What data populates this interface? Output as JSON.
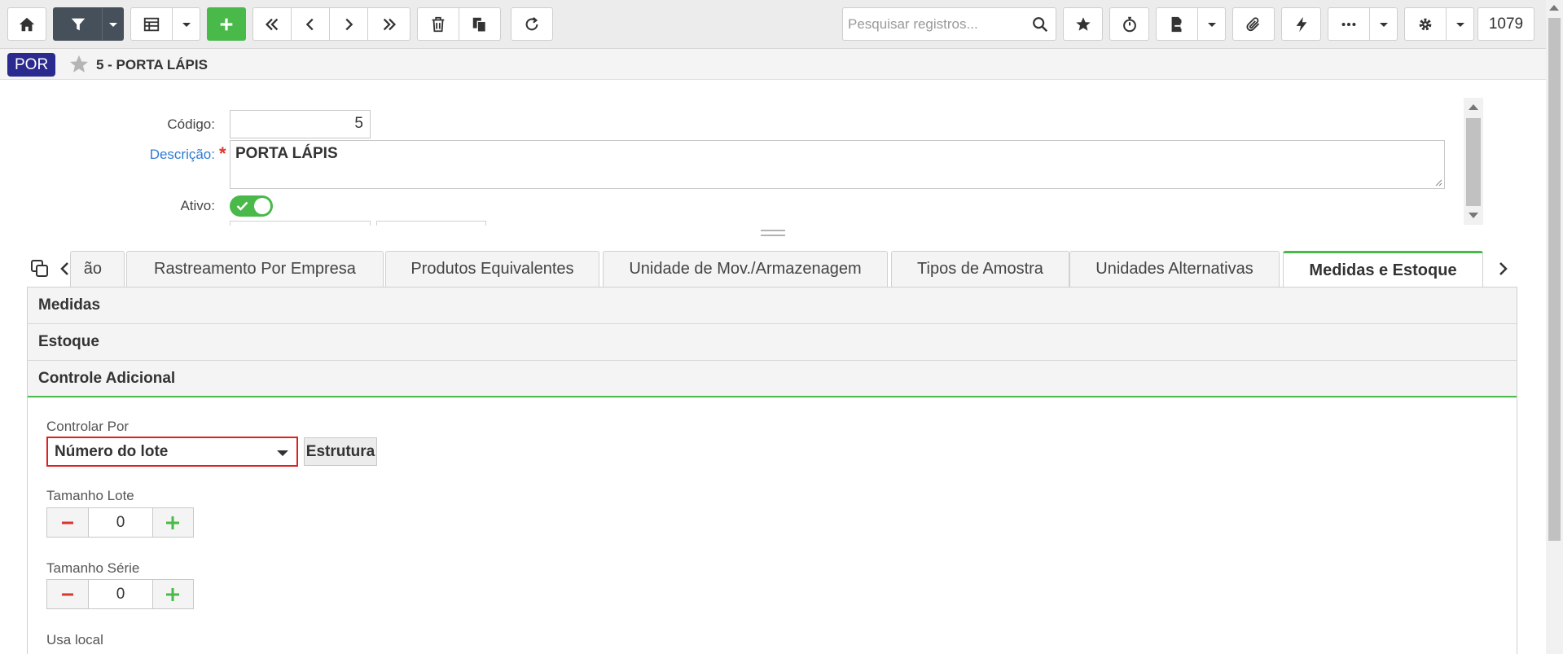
{
  "toolbar": {
    "search_placeholder": "Pesquisar registros...",
    "record_count": "1079"
  },
  "breadcrumb": {
    "badge": "POR",
    "title": "5 - PORTA LÁPIS"
  },
  "form": {
    "codigo_label": "Código:",
    "codigo_value": "5",
    "descricao_label": "Descrição:",
    "required_mark": "*",
    "descricao_value": "PORTA LÁPIS",
    "ativo_label": "Ativo:",
    "ativo_on": true
  },
  "tabs": [
    {
      "label": "ão",
      "active": false
    },
    {
      "label": "Rastreamento Por Empresa",
      "active": false
    },
    {
      "label": "Produtos Equivalentes",
      "active": false
    },
    {
      "label": "Unidade de Mov./Armazenagem",
      "active": false
    },
    {
      "label": "Tipos de Amostra",
      "active": false
    },
    {
      "label": "Unidades Alternativas",
      "active": false
    },
    {
      "label": "Medidas e Estoque",
      "active": true
    }
  ],
  "sections": {
    "medidas": "Medidas",
    "estoque": "Estoque",
    "controle": "Controle Adicional"
  },
  "controle": {
    "controlar_label": "Controlar Por",
    "controlar_value": "Número do lote",
    "estrutura_label": "Estrutura",
    "tamanho_lote_label": "Tamanho Lote",
    "tamanho_lote_value": "0",
    "tamanho_serie_label": "Tamanho Série",
    "tamanho_serie_value": "0",
    "usa_local_label": "Usa local"
  },
  "colors": {
    "accent_green": "#49b94a",
    "badge_blue": "#2a2a8f",
    "link_blue": "#2f7bd4",
    "highlight_red": "#e02020"
  }
}
